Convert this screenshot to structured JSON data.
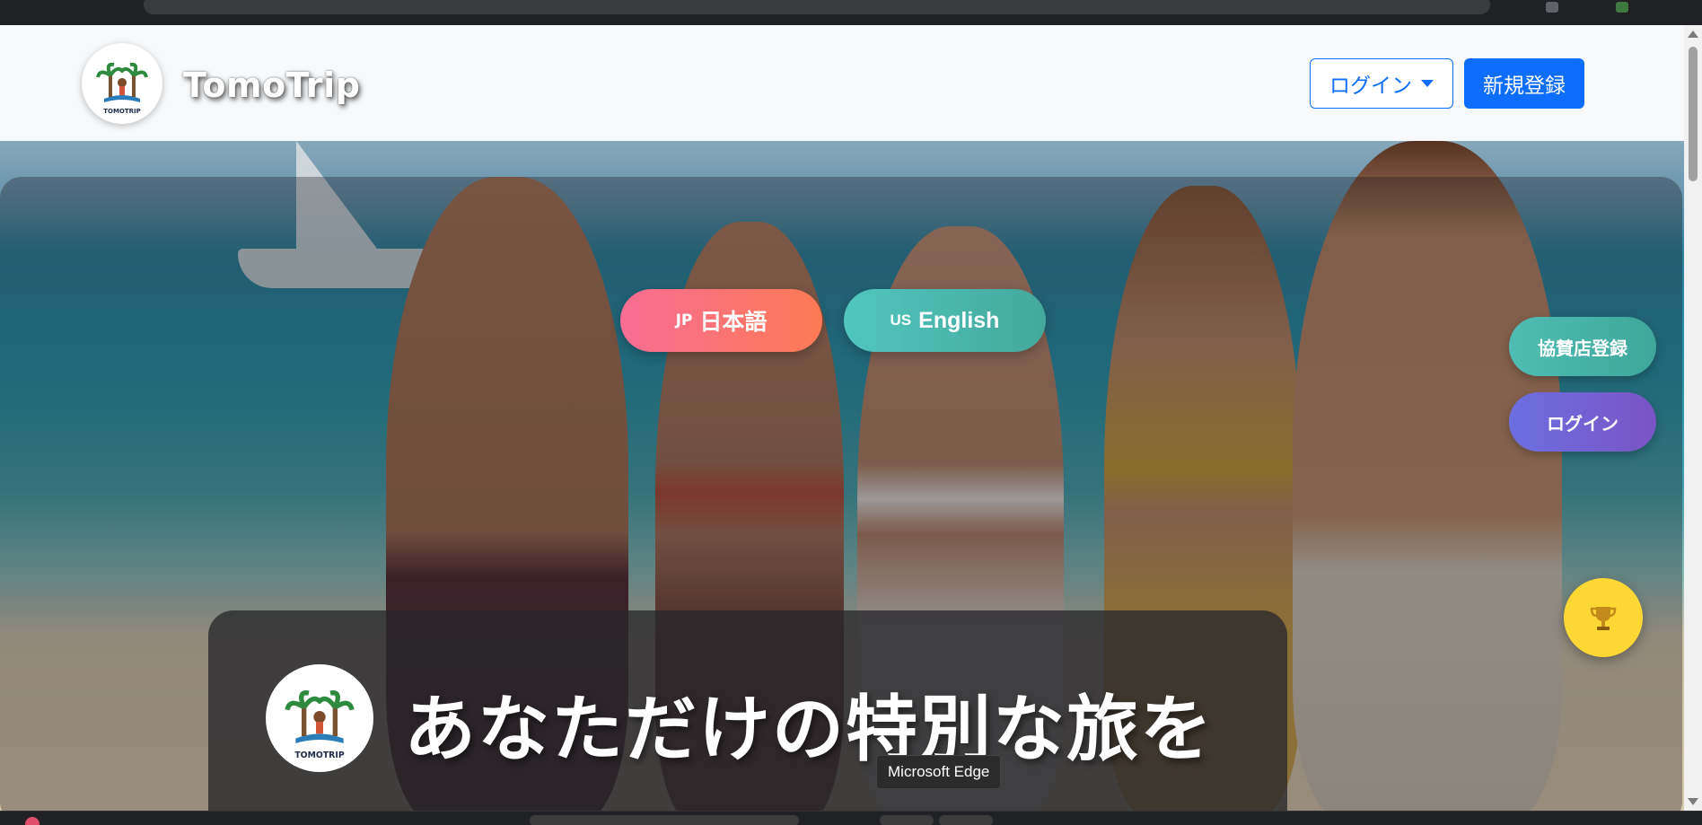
{
  "header": {
    "brand": "TomoTrip",
    "logo_text": "TOMOTRIP",
    "login_label": "ログイン",
    "register_label": "新規登録"
  },
  "hero": {
    "lang_jp_flag": "JP",
    "lang_jp_label": "日本語",
    "lang_en_flag": "US",
    "lang_en_label": "English",
    "sponsor_label": "協賛店登録",
    "side_login_label": "ログイン",
    "title": "あなただけの特別な旅を"
  },
  "tooltip": "Microsoft Edge",
  "icons": {
    "trophy": "trophy-icon",
    "caret": "caret-down-icon"
  },
  "colors": {
    "primary": "#0d6efd",
    "jp_gradient": [
      "#f86d94",
      "#fd7a54"
    ],
    "en_gradient": [
      "#51c6bf",
      "#44a89c"
    ],
    "sponsor": "#4fbdb3",
    "login2": "#7263d6",
    "trophy": "#fdd835"
  }
}
